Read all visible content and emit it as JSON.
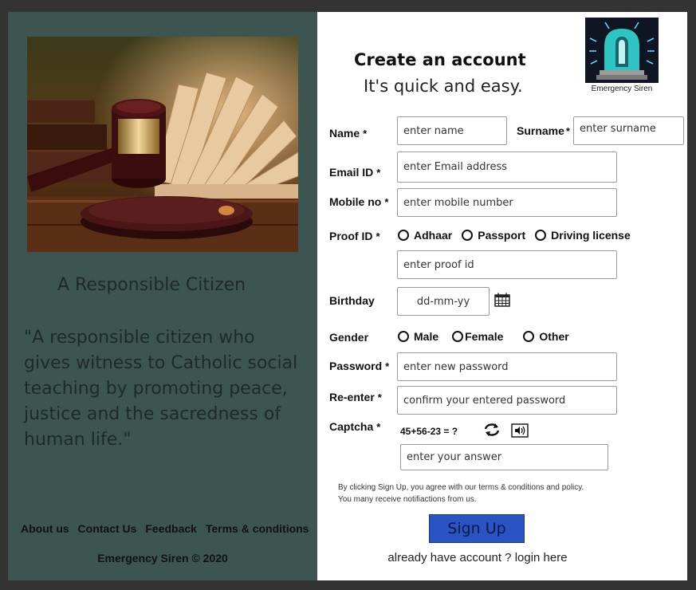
{
  "left": {
    "title": "A Responsible Citizen",
    "quote": "\"A responsible citizen who gives witness to Catholic social teaching by promoting peace, justice and the sacredness of human life.\"",
    "footer_links": [
      "About us",
      "Contact Us",
      "Feedback",
      "Terms & conditions"
    ],
    "copyright": "Emergency Siren ©  2020"
  },
  "header": {
    "title": "Create an account",
    "subtitle": "It's quick and easy.",
    "logo_caption": "Emergency Siren"
  },
  "form": {
    "name": {
      "label": "Name",
      "placeholder": "enter name"
    },
    "surname": {
      "label": "Surname",
      "placeholder": "enter surname"
    },
    "email": {
      "label": "Email ID",
      "placeholder": "enter Email address"
    },
    "mobile": {
      "label": "Mobile no",
      "placeholder": "enter mobile number"
    },
    "proof": {
      "label": "Proof ID",
      "options": [
        "Adhaar",
        "Passport",
        "Driving license"
      ],
      "placeholder": "enter proof id"
    },
    "birthday": {
      "label": "Birthday",
      "placeholder": "dd-mm-yy"
    },
    "gender": {
      "label": "Gender",
      "options": [
        "Male",
        "Female",
        "Other"
      ]
    },
    "password": {
      "label": "Password",
      "placeholder": "enter new password"
    },
    "reenter": {
      "label": "Re-enter",
      "placeholder": "confirm your entered password"
    },
    "captcha": {
      "label": "Captcha",
      "question": "45+56-23 = ?",
      "placeholder": "enter your answer"
    },
    "required_mark": "*"
  },
  "terms": [
    "By clicking Sign Up, you agree with our terms & conditions and policy.",
    "You many receive notifiactions from us."
  ],
  "signup_label": "Sign Up",
  "login_link": "already have account ? login here",
  "colors": {
    "left_panel": "#3c5550",
    "signup_button": "#2a54c4",
    "logo_accent": "#2ec4c4"
  }
}
